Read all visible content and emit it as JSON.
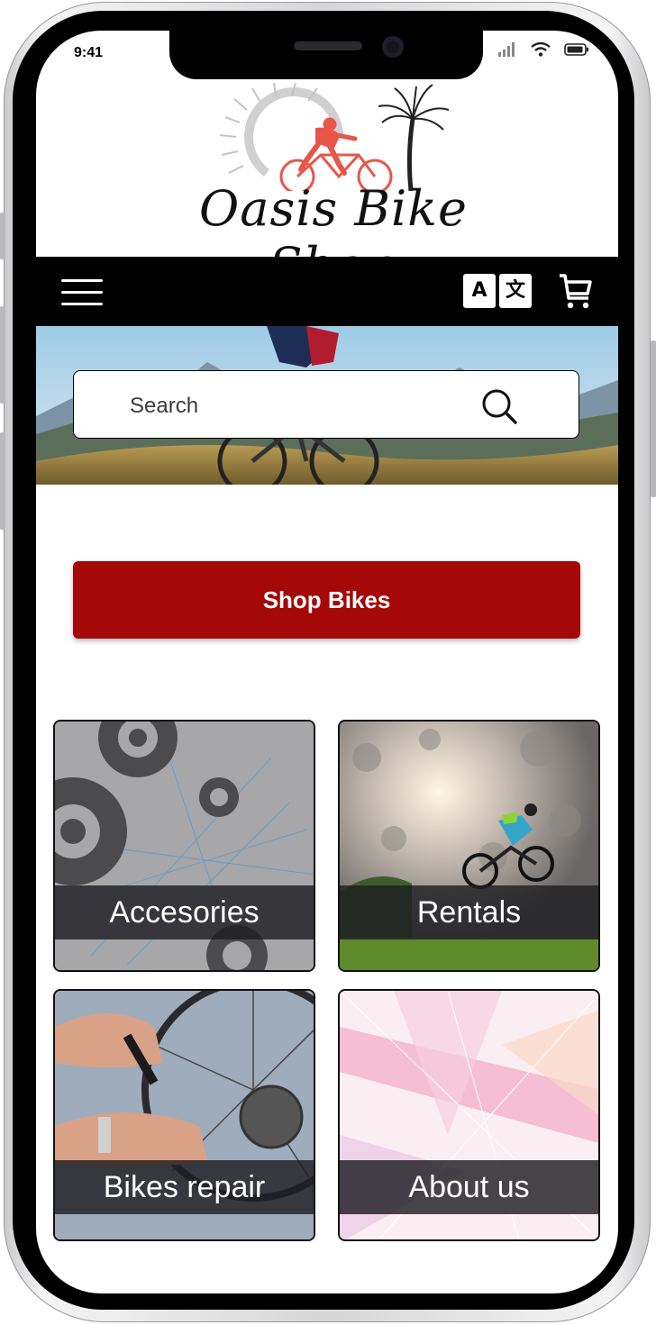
{
  "status_bar": {
    "time": "9:41",
    "icons": [
      "cellular-icon",
      "wifi-icon",
      "battery-icon"
    ]
  },
  "logo": {
    "text": "Oasis Bike Shop",
    "colors": {
      "cyclist": "#e8564a",
      "sun": "#bdbdbd",
      "palm": "#222222"
    }
  },
  "nav": {
    "menu_icon": "hamburger-icon",
    "translate_icon": "translate-icon",
    "translate_left": "A",
    "translate_right": "文",
    "cart_icon": "cart-icon"
  },
  "search": {
    "placeholder": "Search",
    "icon": "search-icon"
  },
  "primary_action": {
    "label": "Shop Bikes",
    "color": "#a50808"
  },
  "categories": [
    {
      "label": "Accesories"
    },
    {
      "label": "Rentals"
    },
    {
      "label": "Bikes repair"
    },
    {
      "label": "About us"
    }
  ]
}
